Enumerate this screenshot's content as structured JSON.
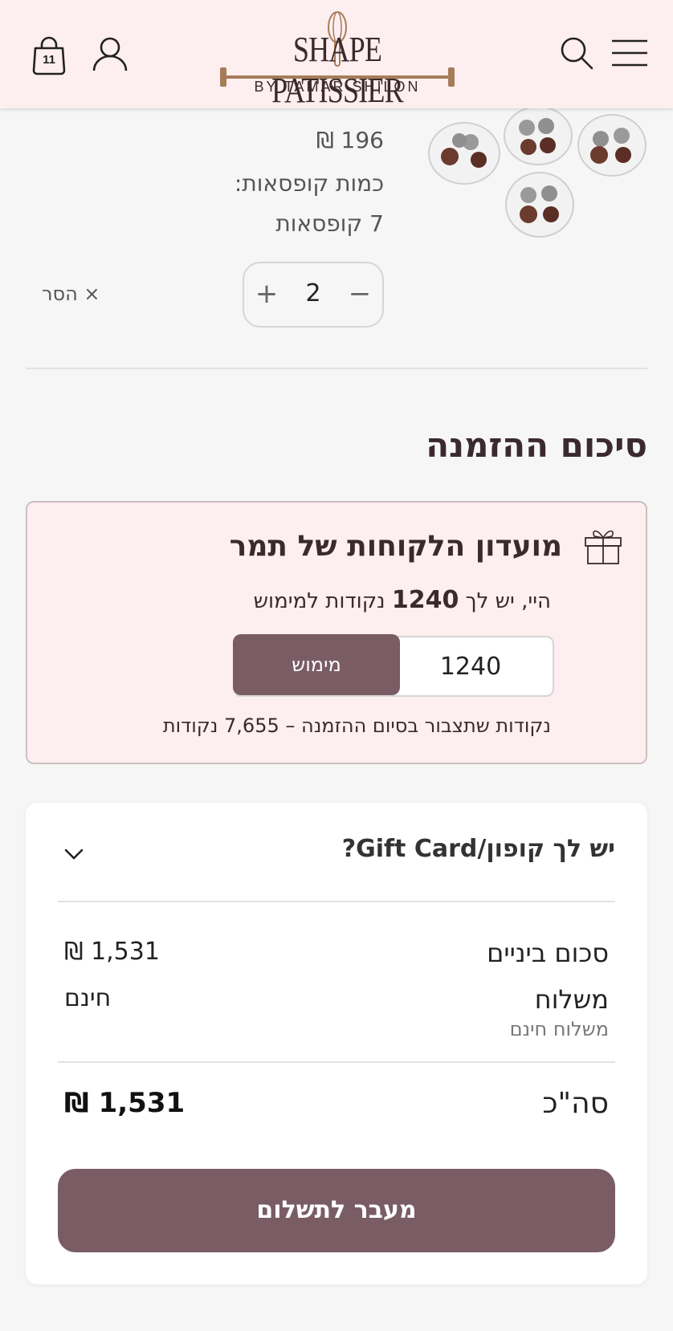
{
  "header": {
    "cart_count": "11",
    "logo_line1": "SHAPE PATISSIER",
    "logo_line2": "BY TAMAR SHILON"
  },
  "product": {
    "price": "196 ₪",
    "qty_label": "כמות קופסאות:",
    "qty_value": "7 קופסאות",
    "stepper_value": "2",
    "stepper_plus": "+",
    "stepper_minus": "−",
    "remove_label": "× הסר"
  },
  "summary": {
    "title": "סיכום ההזמנה"
  },
  "club": {
    "title": "מועדון הלקוחות של תמר",
    "points_prefix": "היי, יש לך ",
    "points_amount": "1240",
    "points_suffix": " נקודות למימוש",
    "input_value": "1240",
    "redeem_label": "מימוש",
    "future_points": "נקודות שתצבור בסיום ההזמנה –  7,655 נקודות"
  },
  "order": {
    "coupon_title": "יש לך קופון/Gift Card?",
    "subtotal_label": "סכום ביניים",
    "subtotal_value": "1,531 ₪",
    "shipping_label": "משלוח",
    "shipping_value": "חינם",
    "shipping_sub": "משלוח חינם",
    "total_label": "סה\"כ",
    "total_value": "1,531 ₪",
    "checkout_label": "מעבר לתשלום"
  },
  "colors": {
    "brand": "#7a5c65",
    "header_bg": "#fdeef0",
    "logo_accent": "#a77c59"
  }
}
